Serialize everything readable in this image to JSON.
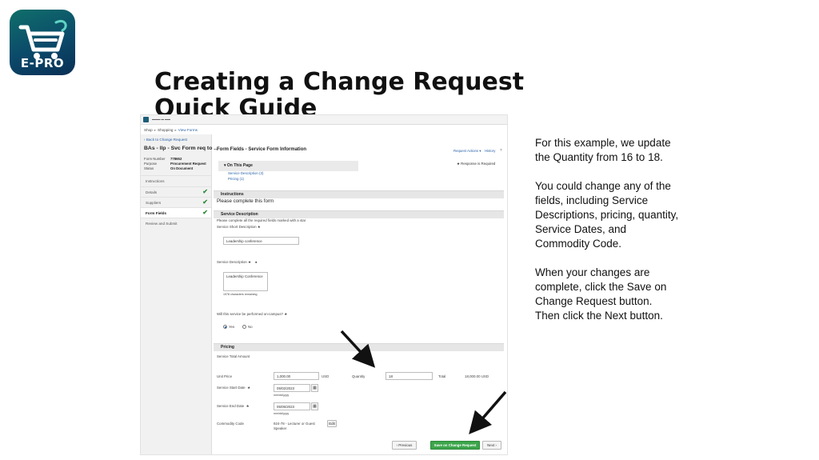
{
  "logo": {
    "text": "E-PRO"
  },
  "slide": {
    "title": "Creating a Change Request Quick Guide",
    "instructions": [
      "For this example, we update the Quantity from 16 to 18.",
      "You could change any of the fields, including Service Descriptions, pricing, quantity, Service Dates, and Commodity Code.",
      "When your changes are complete, click the Save on Change Request button. Then click the Next button."
    ]
  },
  "screenshot": {
    "breadcrumb": {
      "shop": "Shop",
      "shopping": "Shopping",
      "view_forms": "View Forms"
    },
    "back_link": "Back to Change Request",
    "doc_title": "BAs - llp - Svc Form req to ...",
    "meta": [
      {
        "label": "Form Number",
        "value": "778652"
      },
      {
        "label": "Purpose",
        "value": "Procurement Request"
      },
      {
        "label": "Status",
        "value": "On Document"
      }
    ],
    "nav": [
      {
        "label": "Instructions",
        "checked": false
      },
      {
        "label": "Details",
        "checked": true
      },
      {
        "label": "Suppliers",
        "checked": true
      },
      {
        "label": "Form Fields",
        "checked": true,
        "active": true
      },
      {
        "label": "Review and Submit",
        "checked": false
      }
    ],
    "check_glyph": "✔",
    "section_title": "Form Fields - Service Form Information",
    "request_actions": "Request Actions ▾",
    "history": "History",
    "on_this_page": "On This Page",
    "page_links": [
      "Service Description (3)",
      "Pricing (1)"
    ],
    "required_note": "Response is Required",
    "instructions_header": "Instructions",
    "instructions_text": "Please complete this form",
    "service_header": "Service Description",
    "service_note": "Please complete all the required fields marked with a star",
    "short_desc_label": "Service Short Description",
    "short_desc_value": "Leadership conference",
    "desc_label": "Service Description",
    "desc_value": "Leadership Conference",
    "chars_remaining": "1978 characters remaining",
    "oncampus_label": "Will this service be performed on-campus?",
    "radio_yes": "Yes",
    "radio_no": "No",
    "pricing_header": "Pricing",
    "total_amount_label": "Service Total Amount",
    "unit_price_label": "Unit Price",
    "unit_price_value": "1,000.00",
    "currency": "USD",
    "quantity_label": "Quantity",
    "quantity_value": "18",
    "total_label": "Total",
    "total_value": "18,000.00 USD",
    "start_date_label": "Service Start Date",
    "start_date_value": "05/02/2023",
    "end_date_label": "Service End Date",
    "end_date_value": "05/05/2023",
    "date_hint": "mm/dd/yyyy",
    "commodity_label": "Commodity Code",
    "commodity_value": "924-78 - Lecturer or Guest Speaker",
    "edit_label": "Edit",
    "prev_button": "‹ Previous",
    "save_button": "Save on Change Request",
    "next_button": "Next ›"
  },
  "colors": {
    "accent_green": "#3ba54a",
    "link_blue": "#2a63a8",
    "logo_teal": "#0f6f6a"
  }
}
